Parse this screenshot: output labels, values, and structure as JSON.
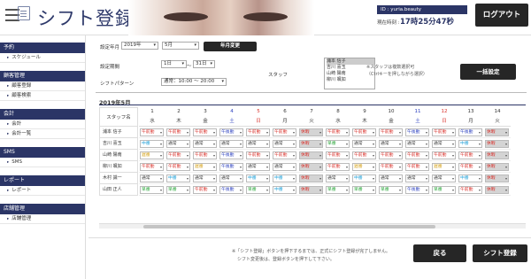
{
  "header": {
    "title": "シフト登録",
    "user_id": "ID : yuria.beauty",
    "clock_label": "現在時刻 :",
    "clock": "17時25分47秒",
    "logout": "ログアウト"
  },
  "sidebar": [
    {
      "title": "予約",
      "items": [
        "スケジュール"
      ]
    },
    {
      "title": "顧客管理",
      "items": [
        "顧客登録",
        "顧客検索"
      ]
    },
    {
      "title": "会計",
      "items": [
        "会計",
        "会計一覧"
      ]
    },
    {
      "title": "SMS",
      "items": [
        "SMS"
      ]
    },
    {
      "title": "レポート",
      "items": [
        "レポート"
      ]
    },
    {
      "title": "店舗管理",
      "items": [
        "店舗管理"
      ]
    }
  ],
  "form": {
    "year_month_label": "設定年月",
    "year": "2019年",
    "month": "5月",
    "change_btn": "年月変更",
    "period_label": "設定期間",
    "from_day": "1日",
    "tilde": "〜",
    "to_day": "31日",
    "pattern_label": "シフトパターン",
    "pattern": "通常：10:00 〜 20:00",
    "staff_label": "スタッフ",
    "staff_options": [
      "浦本 信子",
      "吉川 喜玉",
      "山崎 陽南",
      "柳川 颯如"
    ],
    "note_line1": "※スタッフは複数選択可",
    "note_line2": "（Ctrlキーを押しながら選択）",
    "bulk_btn": "一括設定"
  },
  "schedule": {
    "month_title": "2019年5月",
    "name_header": "スタッフ名",
    "staff": [
      "浦本 信子",
      "吉川 喜玉",
      "山崎 陽南",
      "柳川 颯如",
      "木村 識一",
      "山田 正人"
    ],
    "days": [
      {
        "num": "1",
        "wd": "水",
        "color": "#333333"
      },
      {
        "num": "2",
        "wd": "木",
        "color": "#333333"
      },
      {
        "num": "3",
        "wd": "金",
        "color": "#333333"
      },
      {
        "num": "4",
        "wd": "土",
        "color": "#2b3fbf"
      },
      {
        "num": "5",
        "wd": "日",
        "color": "#d9312b"
      },
      {
        "num": "6",
        "wd": "月",
        "color": "#333333"
      },
      {
        "num": "7",
        "wd": "火",
        "color": "#333333"
      },
      {
        "num": "8",
        "wd": "水",
        "color": "#333333"
      },
      {
        "num": "9",
        "wd": "木",
        "color": "#333333"
      },
      {
        "num": "10",
        "wd": "金",
        "color": "#333333"
      },
      {
        "num": "11",
        "wd": "土",
        "color": "#2b3fbf"
      },
      {
        "num": "12",
        "wd": "日",
        "color": "#d9312b"
      },
      {
        "num": "13",
        "wd": "月",
        "color": "#333333"
      },
      {
        "num": "14",
        "wd": "火",
        "color": "#333333"
      }
    ],
    "shifts": [
      [
        "午前勤",
        "午前勤",
        "午前勤",
        "午後勤",
        "午前勤",
        "午前勤",
        "休暇",
        "午前勤",
        "午前勤",
        "午前勤",
        "午後勤",
        "午前勤",
        "午後勤",
        "休暇"
      ],
      [
        "中番",
        "通常",
        "通常",
        "通常",
        "通常",
        "通常",
        "休暇",
        "早番",
        "通常",
        "通常",
        "通常",
        "通常",
        "中番",
        "休暇"
      ],
      [
        "遅番",
        "午前勤",
        "午前勤",
        "午後勤",
        "午前勤",
        "午前勤",
        "休暇",
        "午前勤",
        "午前勤",
        "午前勤",
        "午前勤",
        "午前勤",
        "午前勤",
        "休暇"
      ],
      [
        "午前勤",
        "午前勤",
        "遅番",
        "午後勤",
        "通常",
        "通常",
        "休暇",
        "午前勤",
        "遅番",
        "午前勤",
        "午前勤",
        "遅番",
        "午前勤",
        "休暇"
      ],
      [
        "通常",
        "中番",
        "通常",
        "通常",
        "中番",
        "中番",
        "休暇",
        "通常",
        "中番",
        "通常",
        "通常",
        "通常",
        "中番",
        "休暇"
      ],
      [
        "早番",
        "早番",
        "午前勤",
        "午後勤",
        "早番",
        "中番",
        "休暇",
        "早番",
        "早番",
        "早番",
        "午後勤",
        "早番",
        "午前勤",
        "休暇"
      ]
    ],
    "shift_colors": {
      "午前勤": "#d9312b",
      "午後勤": "#2b3fbf",
      "通常": "#333333",
      "中番": "#1fa0d8",
      "早番": "#2aa53a",
      "遅番": "#d4a017",
      "休暇": "#d9312b"
    },
    "holiday_bg": "#d4d4d4"
  },
  "footer": {
    "note_line1": "※「シフト登録」ボタンを押下するまでは、正式にシフト登録が完了しません。",
    "note_line2": "シフト変更後は、登録ボタンを押下して下さい。",
    "back": "戻る",
    "register": "シフト登録"
  }
}
